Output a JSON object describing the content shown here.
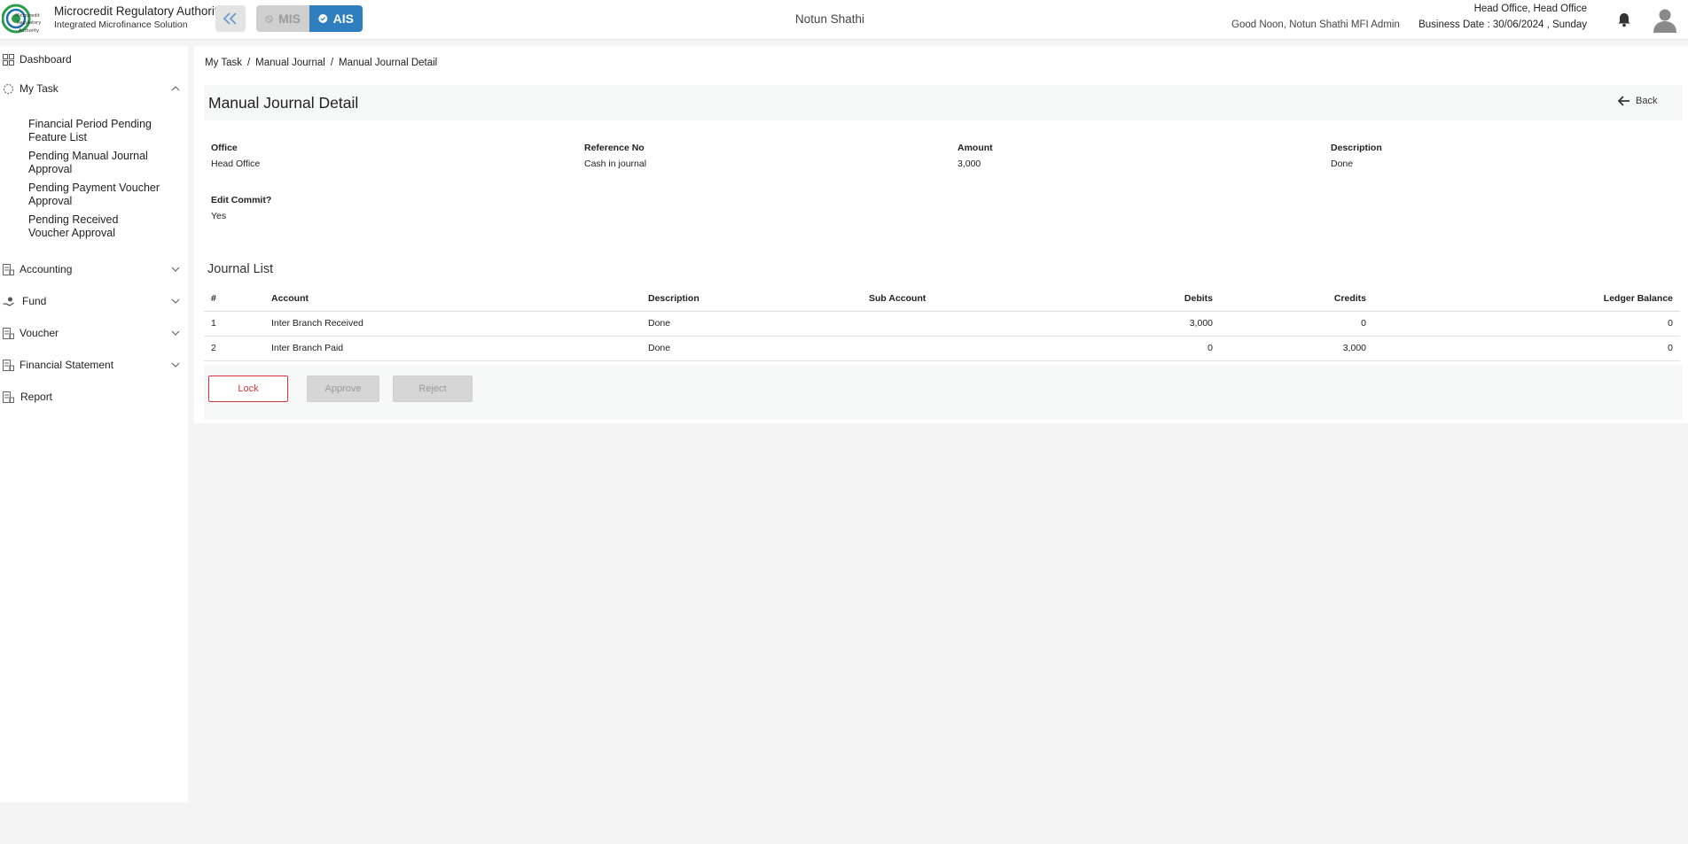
{
  "header": {
    "brand_title": "Microcredit Regulatory Authority",
    "brand_subtitle": "Integrated Microfinance Solution",
    "logo_text": "Microcredit Regulatory Authority",
    "mode_mis": "MIS",
    "mode_ais": "AIS",
    "organization": "Notun Shathi",
    "greeting": "Good Noon, Notun Shathi MFI Admin",
    "office": "Head Office, Head Office",
    "business_date": "Business Date : 30/06/2024 , Sunday"
  },
  "sidebar": {
    "dashboard": "Dashboard",
    "my_task": "My Task",
    "my_task_items": [
      "Financial Period Pending Feature List",
      "Pending Manual Journal Approval",
      "Pending Payment Voucher Approval",
      "Pending Received Voucher Approval"
    ],
    "accounting": "Accounting",
    "fund": "Fund",
    "voucher": "Voucher",
    "financial_statement": "Financial Statement",
    "report": "Report"
  },
  "breadcrumb": [
    "My Task",
    "Manual Journal",
    "Manual Journal Detail"
  ],
  "page": {
    "title": "Manual Journal Detail",
    "back": "Back"
  },
  "detail": {
    "office_label": "Office",
    "office_value": "Head Office",
    "reference_label": "Reference No",
    "reference_value": "Cash in journal",
    "amount_label": "Amount",
    "amount_value": "3,000",
    "description_label": "Description",
    "description_value": "Done",
    "edit_commit_label": "Edit Commit?",
    "edit_commit_value": "Yes"
  },
  "journal": {
    "title": "Journal List",
    "columns": [
      "#",
      "Account",
      "Description",
      "Sub Account",
      "Debits",
      "Credits",
      "Ledger Balance"
    ],
    "rows": [
      [
        "1",
        "Inter Branch Received",
        "Done",
        "",
        "3,000",
        "0",
        "0"
      ],
      [
        "2",
        "Inter Branch Paid",
        "Done",
        "",
        "0",
        "3,000",
        "0"
      ]
    ]
  },
  "actions": {
    "lock": "Lock",
    "approve": "Approve",
    "reject": "Reject"
  },
  "colors": {
    "accent": "#2f7fc0",
    "danger": "#d8343e",
    "logo_green": "#2a9d4a"
  }
}
